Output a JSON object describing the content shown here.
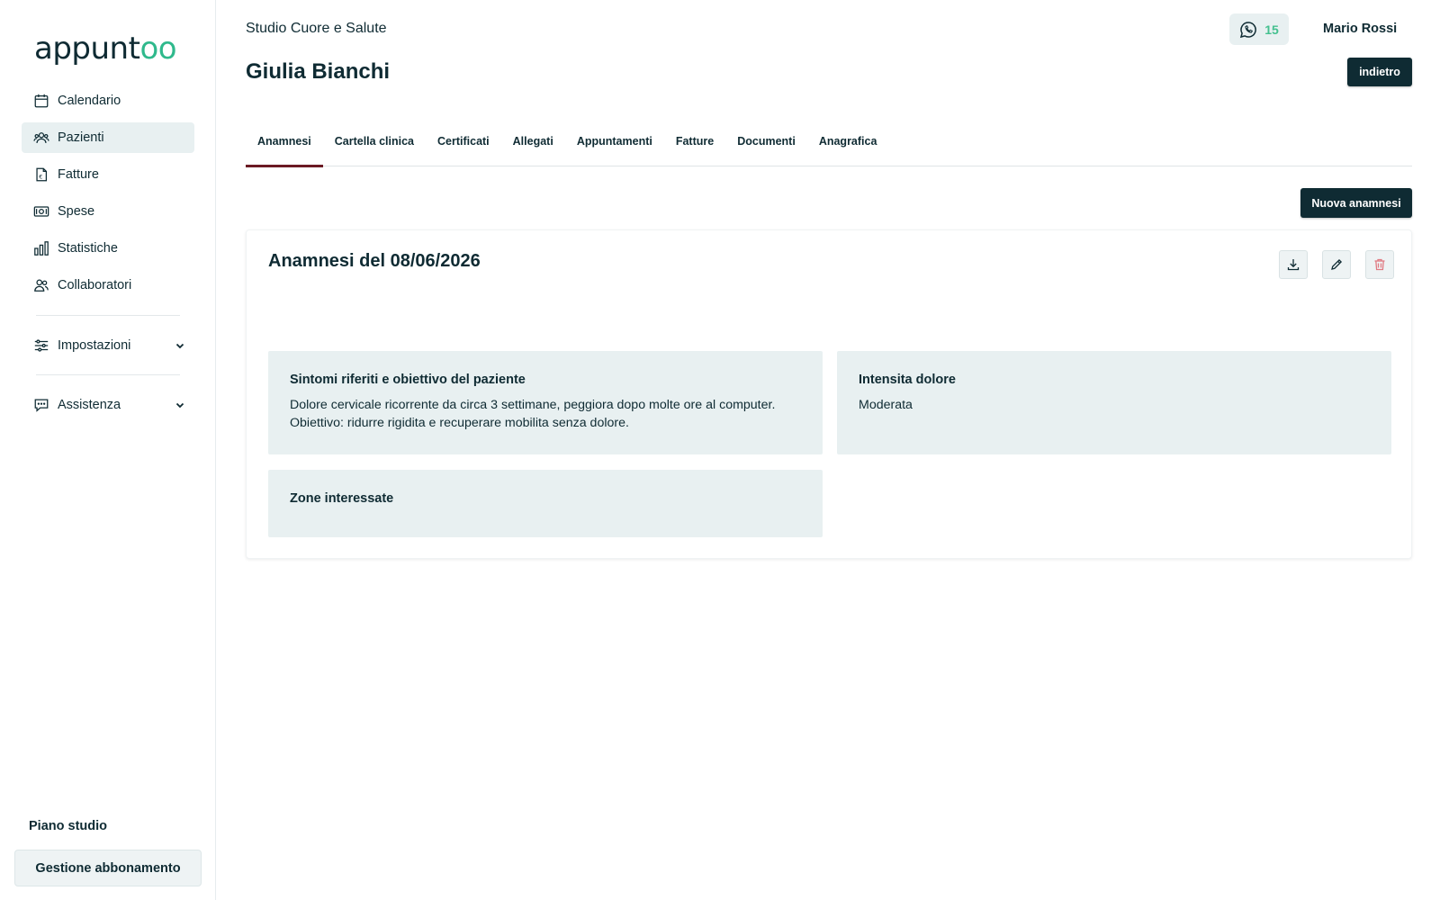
{
  "brand": {
    "logo_main": "appunt",
    "logo_accent": "oo",
    "accent_color": "#2fb98c",
    "primary_color": "#0f2b33"
  },
  "sidebar": {
    "items": [
      {
        "label": "Calendario",
        "icon": "calendar-icon"
      },
      {
        "label": "Pazienti",
        "icon": "users-icon",
        "active": true
      },
      {
        "label": "Fatture",
        "icon": "invoice-icon"
      },
      {
        "label": "Spese",
        "icon": "money-icon"
      },
      {
        "label": "Statistiche",
        "icon": "bar-chart-icon"
      },
      {
        "label": "Collaboratori",
        "icon": "collaborators-icon"
      }
    ],
    "settings_label": "Impostazioni",
    "support_label": "Assistenza",
    "plan_title": "Piano studio",
    "plan_button": "Gestione abbonamento"
  },
  "header": {
    "studio_name": "Studio Cuore e Salute",
    "patient_name": "Giulia Bianchi",
    "whatsapp_count": "15",
    "user_name": "Mario Rossi",
    "back_label": "indietro"
  },
  "tabs": [
    {
      "label": "Anamnesi",
      "active": true
    },
    {
      "label": "Cartella clinica"
    },
    {
      "label": "Certificati"
    },
    {
      "label": "Allegati"
    },
    {
      "label": "Appuntamenti"
    },
    {
      "label": "Fatture"
    },
    {
      "label": "Documenti"
    },
    {
      "label": "Anagrafica"
    }
  ],
  "main": {
    "new_button": "Nuova anamnesi",
    "card": {
      "title": "Anamnesi del 08/06/2026",
      "panels": {
        "symptoms": {
          "title": "Sintomi riferiti e obiettivo del paziente",
          "line1": "Dolore cervicale ricorrente da circa 3 settimane, peggiora dopo molte ore al computer.",
          "line2": "Obiettivo: ridurre rigidita e recuperare mobilita senza dolore."
        },
        "pain": {
          "title": "Intensita dolore",
          "value": "Moderata"
        },
        "zones": {
          "title": "Zone interessate"
        }
      }
    }
  }
}
